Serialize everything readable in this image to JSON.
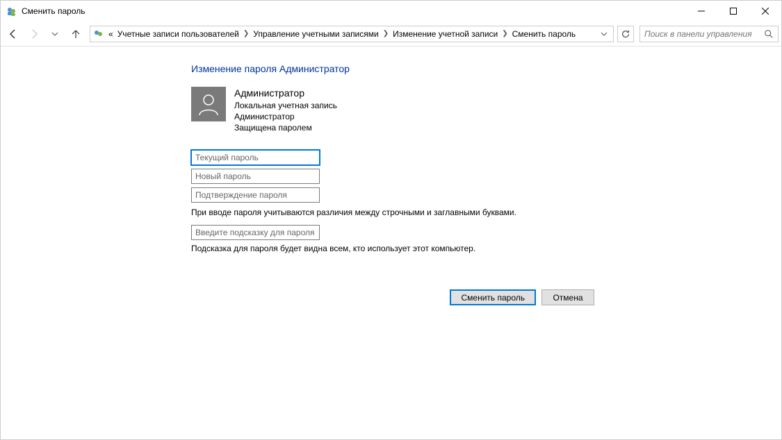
{
  "window": {
    "title": "Сменить пароль"
  },
  "breadcrumb": {
    "prefix": "«",
    "items": [
      "Учетные записи пользователей",
      "Управление учетными записями",
      "Изменение учетной записи",
      "Сменить пароль"
    ]
  },
  "search": {
    "placeholder": "Поиск в панели управления"
  },
  "page": {
    "heading": "Изменение пароля Администратор"
  },
  "account": {
    "name": "Администратор",
    "type": "Локальная учетная запись",
    "role": "Администратор",
    "protection": "Защищена паролем"
  },
  "fields": {
    "current_password_ph": "Текущий пароль",
    "new_password_ph": "Новый пароль",
    "confirm_password_ph": "Подтверждение пароля",
    "hint_ph": "Введите подсказку для пароля"
  },
  "notes": {
    "case_sensitive": "При вводе пароля учитываются различия между строчными и заглавными буквами.",
    "hint_visible": "Подсказка для пароля будет видна всем, кто использует этот компьютер."
  },
  "buttons": {
    "submit": "Сменить пароль",
    "cancel": "Отмена"
  }
}
